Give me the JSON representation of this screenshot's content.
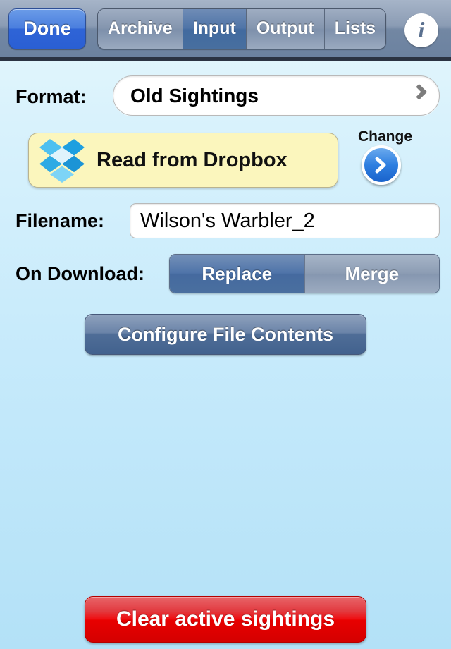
{
  "toolbar": {
    "done_label": "Done",
    "tabs": [
      {
        "label": "Archive",
        "selected": false
      },
      {
        "label": "Input",
        "selected": true
      },
      {
        "label": "Output",
        "selected": false
      },
      {
        "label": "Lists",
        "selected": false
      }
    ],
    "info_glyph": "i",
    "selected_tab": "Input"
  },
  "format_row": {
    "label": "Format:",
    "value": "Old Sightings"
  },
  "dropbox_row": {
    "action_label": "Read from Dropbox",
    "change_label": "Change"
  },
  "filename_row": {
    "label": "Filename:",
    "value": "Wilson's Warbler_2",
    "placeholder": "Filename"
  },
  "download_row": {
    "label": "On Download:",
    "options": [
      {
        "label": "Replace",
        "selected": true
      },
      {
        "label": "Merge",
        "selected": false
      }
    ],
    "selected": "Replace"
  },
  "configure_button": {
    "label": "Configure File Contents"
  },
  "clear_button": {
    "label": "Clear active sightings"
  },
  "colors": {
    "accent_blue": "#2f64d6",
    "toolbar_bg": "#7287a3",
    "page_bg_top": "#e7f8fd",
    "page_bg_bottom": "#b3e1f7",
    "dropbox_panel_bg": "#fbf6bd",
    "dropbox_logo_blue": "#2daae4",
    "danger_red": "#e80000",
    "segment_selected": "#4f74a7"
  }
}
